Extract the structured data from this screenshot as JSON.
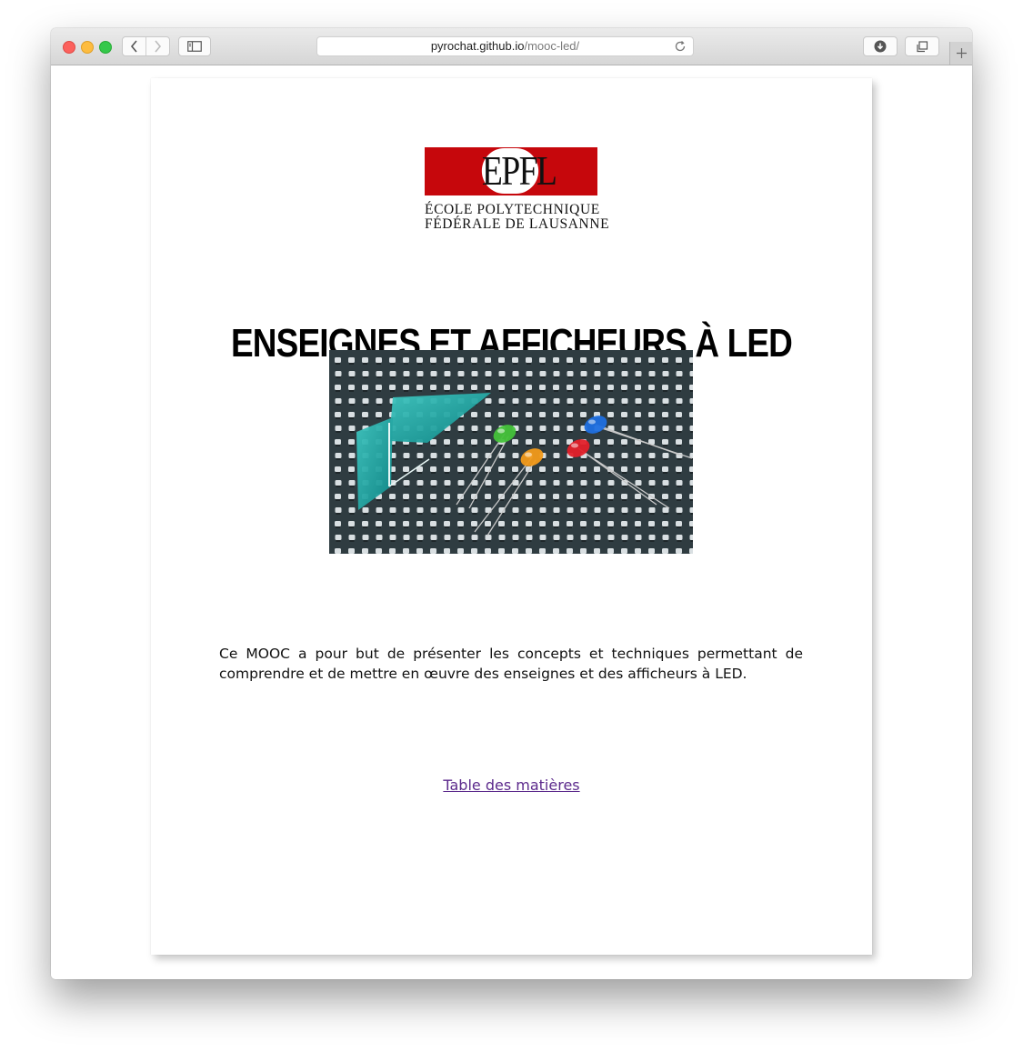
{
  "browser": {
    "url_host": "pyrochat.github.io",
    "url_path": "/mooc-led/",
    "icons": {
      "back": "chevron-left-icon",
      "forward": "chevron-right-icon",
      "sidebar": "sidebar-icon",
      "reload": "reload-icon",
      "downloads": "download-icon",
      "tabs": "tabs-overview-icon",
      "new_tab": "plus-icon"
    }
  },
  "page": {
    "logo": {
      "mark": "EPFL",
      "line1": "ÉCOLE POLYTECHNIQUE",
      "line2": "FÉDÉRALE DE LAUSANNE",
      "color": "#c6070c"
    },
    "title": "ENSEIGNES ET AFFICHEURS À LED",
    "description": "Ce MOOC a pour but de présenter les concepts et techniques permettant de comprendre et de mettre en œuvre des enseignes et des afficheurs à LED.",
    "toc_link": "Table des matières",
    "link_color": "#5c2a8c"
  }
}
